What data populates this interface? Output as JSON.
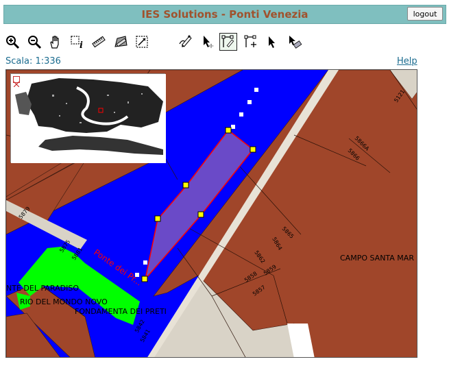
{
  "header": {
    "title": "IES Solutions - Ponti Venezia",
    "logout_label": "logout"
  },
  "toolbar": {
    "tools": [
      {
        "name": "zoom-in-icon"
      },
      {
        "name": "zoom-out-icon"
      },
      {
        "name": "pan-hand-icon"
      },
      {
        "name": "identify-info-icon"
      },
      {
        "name": "measure-ruler-icon"
      },
      {
        "name": "measure-area-icon"
      },
      {
        "name": "zoom-box-icon"
      },
      {
        "name": "edit-pencil-icon"
      },
      {
        "name": "select-move-icon"
      },
      {
        "name": "draw-polygon-icon",
        "active": true
      },
      {
        "name": "add-vertex-icon"
      },
      {
        "name": "select-arrow-icon"
      },
      {
        "name": "erase-select-icon"
      }
    ]
  },
  "status": {
    "scale": "Scala: 1:336",
    "help_label": "Help"
  },
  "map": {
    "labels": {
      "campo": "CAMPO SANTA MAR",
      "paradiso": "NTE DEL PARADISO",
      "rio": "RIO DEL MONDO NOVO",
      "fondamenta": "FONDAMENTA DEI PRETI",
      "ponte": "Ponte dei Pr..."
    },
    "numbers": {
      "n5121": "5121",
      "n5866a": "5866A",
      "n5866": "5866",
      "n5865": "5865",
      "n5864": "5864",
      "n5862": "5862",
      "n5859": "5859",
      "n5858": "5858",
      "n5857": "5857",
      "n5879": "5879",
      "n5875": "5875",
      "n5881": "5881",
      "n5842": "5842",
      "n5841": "5841"
    },
    "colors": {
      "buildings": "#a0462a",
      "water": "#0000ff",
      "bridge": "#00ff00",
      "selection_fill": "#6a4ac8",
      "selection_outline": "#ff0000",
      "vertex": "#ffff00"
    }
  }
}
